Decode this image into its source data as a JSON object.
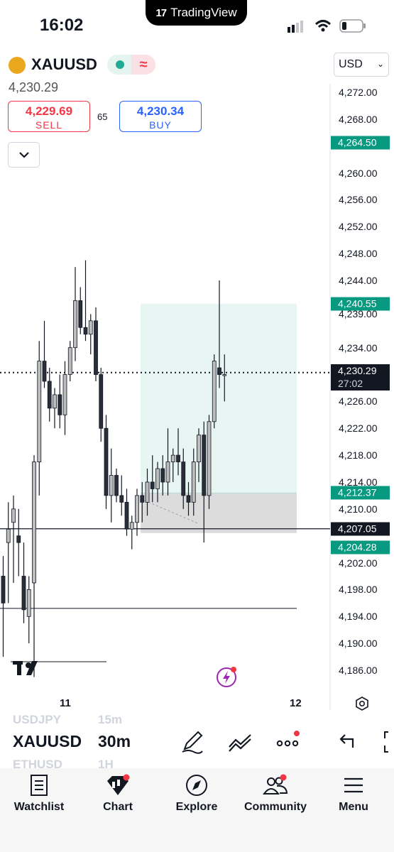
{
  "status_bar": {
    "time": "16:02",
    "island_label": "TradingView"
  },
  "header": {
    "symbol": "XAUUSD",
    "last_price": "4,230.29",
    "sell": {
      "price": "4,229.69",
      "label": "SELL"
    },
    "buy": {
      "price": "4,230.34",
      "label": "BUY"
    },
    "spread": "65",
    "currency": "USD"
  },
  "axis": {
    "price_labels": [
      "4,272.00",
      "4,268.00",
      "4,260.00",
      "4,256.00",
      "4,252.00",
      "4,248.00",
      "4,244.00",
      "4,239.00",
      "4,234.00",
      "4,226.00",
      "4,222.00",
      "4,218.00",
      "4,214.00",
      "4,210.00",
      "4,202.00",
      "4,198.00",
      "4,194.00",
      "4,190.00",
      "4,186.00"
    ],
    "price_tags": [
      {
        "value": "4,264.50",
        "color": "#089981"
      },
      {
        "value": "4,240.55",
        "color": "#089981"
      },
      {
        "value": "4,212.37",
        "color": "#089981"
      },
      {
        "value": "4,207.05",
        "color": "#131722"
      },
      {
        "value": "4,204.28",
        "color": "#089981"
      }
    ],
    "current_price": "4,230.29",
    "countdown": "27:02",
    "time_labels": [
      "11",
      "12"
    ]
  },
  "chart_data": {
    "type": "candlestick",
    "title": "",
    "symbol": "XAUUSD",
    "interval": "30m",
    "ylim": [
      4183,
      4276
    ],
    "x_ticks": [
      "11",
      "12"
    ],
    "current_price": 4230.29,
    "horizontal_lines": [
      4207.05,
      4195.2
    ],
    "long_position": {
      "entry": 4212.37,
      "target": 4240.55,
      "stop": 4207.05
    },
    "candles": [
      {
        "o": 4200,
        "h": 4203,
        "l": 4188,
        "c": 4196
      },
      {
        "o": 4205,
        "h": 4211,
        "l": 4196,
        "c": 4207
      },
      {
        "o": 4208,
        "h": 4212,
        "l": 4199,
        "c": 4210
      },
      {
        "o": 4206,
        "h": 4210,
        "l": 4200,
        "c": 4205
      },
      {
        "o": 4200,
        "h": 4205,
        "l": 4193,
        "c": 4195
      },
      {
        "o": 4194,
        "h": 4200,
        "l": 4190,
        "c": 4198
      },
      {
        "o": 4199,
        "h": 4218,
        "l": 4185,
        "c": 4217
      },
      {
        "o": 4217,
        "h": 4235,
        "l": 4212,
        "c": 4232
      },
      {
        "o": 4232,
        "h": 4238,
        "l": 4228,
        "c": 4229
      },
      {
        "o": 4229,
        "h": 4231,
        "l": 4223,
        "c": 4225
      },
      {
        "o": 4225,
        "h": 4228,
        "l": 4222,
        "c": 4227
      },
      {
        "o": 4227,
        "h": 4230,
        "l": 4222,
        "c": 4224
      },
      {
        "o": 4224,
        "h": 4232,
        "l": 4221,
        "c": 4230
      },
      {
        "o": 4230,
        "h": 4235,
        "l": 4229,
        "c": 4234
      },
      {
        "o": 4234,
        "h": 4246,
        "l": 4232,
        "c": 4241
      },
      {
        "o": 4241,
        "h": 4243,
        "l": 4236,
        "c": 4237
      },
      {
        "o": 4237,
        "h": 4247,
        "l": 4235,
        "c": 4236
      },
      {
        "o": 4236,
        "h": 4239,
        "l": 4233,
        "c": 4238
      },
      {
        "o": 4238,
        "h": 4240,
        "l": 4229,
        "c": 4230
      },
      {
        "o": 4230,
        "h": 4231,
        "l": 4220,
        "c": 4222
      },
      {
        "o": 4222,
        "h": 4224,
        "l": 4210,
        "c": 4212
      },
      {
        "o": 4212,
        "h": 4219,
        "l": 4208,
        "c": 4215
      },
      {
        "o": 4215,
        "h": 4216,
        "l": 4211,
        "c": 4212
      },
      {
        "o": 4212,
        "h": 4215,
        "l": 4209,
        "c": 4211
      },
      {
        "o": 4211,
        "h": 4213,
        "l": 4206,
        "c": 4207
      },
      {
        "o": 4207,
        "h": 4209,
        "l": 4204,
        "c": 4208
      },
      {
        "o": 4208,
        "h": 4213,
        "l": 4206,
        "c": 4212
      },
      {
        "o": 4212,
        "h": 4214,
        "l": 4208,
        "c": 4211
      },
      {
        "o": 4211,
        "h": 4216,
        "l": 4209,
        "c": 4214
      },
      {
        "o": 4214,
        "h": 4218,
        "l": 4211,
        "c": 4213
      },
      {
        "o": 4213,
        "h": 4217,
        "l": 4211,
        "c": 4216
      },
      {
        "o": 4216,
        "h": 4218,
        "l": 4212,
        "c": 4214
      },
      {
        "o": 4214,
        "h": 4222,
        "l": 4212,
        "c": 4217
      },
      {
        "o": 4217,
        "h": 4219,
        "l": 4214,
        "c": 4218
      },
      {
        "o": 4218,
        "h": 4222,
        "l": 4215,
        "c": 4217
      },
      {
        "o": 4217,
        "h": 4219,
        "l": 4210,
        "c": 4212
      },
      {
        "o": 4212,
        "h": 4214,
        "l": 4209,
        "c": 4211
      },
      {
        "o": 4211,
        "h": 4219,
        "l": 4209,
        "c": 4217
      },
      {
        "o": 4217,
        "h": 4222,
        "l": 4214,
        "c": 4221
      },
      {
        "o": 4221,
        "h": 4223,
        "l": 4205,
        "c": 4212
      },
      {
        "o": 4212,
        "h": 4224,
        "l": 4210,
        "c": 4223
      },
      {
        "o": 4223,
        "h": 4233,
        "l": 4222,
        "c": 4232
      },
      {
        "o": 4231,
        "h": 4244,
        "l": 4228,
        "c": 4230
      },
      {
        "o": 4230,
        "h": 4233,
        "l": 4226,
        "c": 4230
      }
    ]
  },
  "toolbar": {
    "symbol": "XAUUSD",
    "symbol_prev": "USDJPY",
    "symbol_next": "ETHUSD",
    "interval": "30m",
    "interval_prev": "15m",
    "interval_next": "1H"
  },
  "nav": {
    "items": [
      {
        "label": "Watchlist",
        "icon": "watchlist-icon"
      },
      {
        "label": "Chart",
        "icon": "chart-icon"
      },
      {
        "label": "Explore",
        "icon": "compass-icon"
      },
      {
        "label": "Community",
        "icon": "community-icon"
      },
      {
        "label": "Menu",
        "icon": "menu-icon"
      }
    ]
  }
}
